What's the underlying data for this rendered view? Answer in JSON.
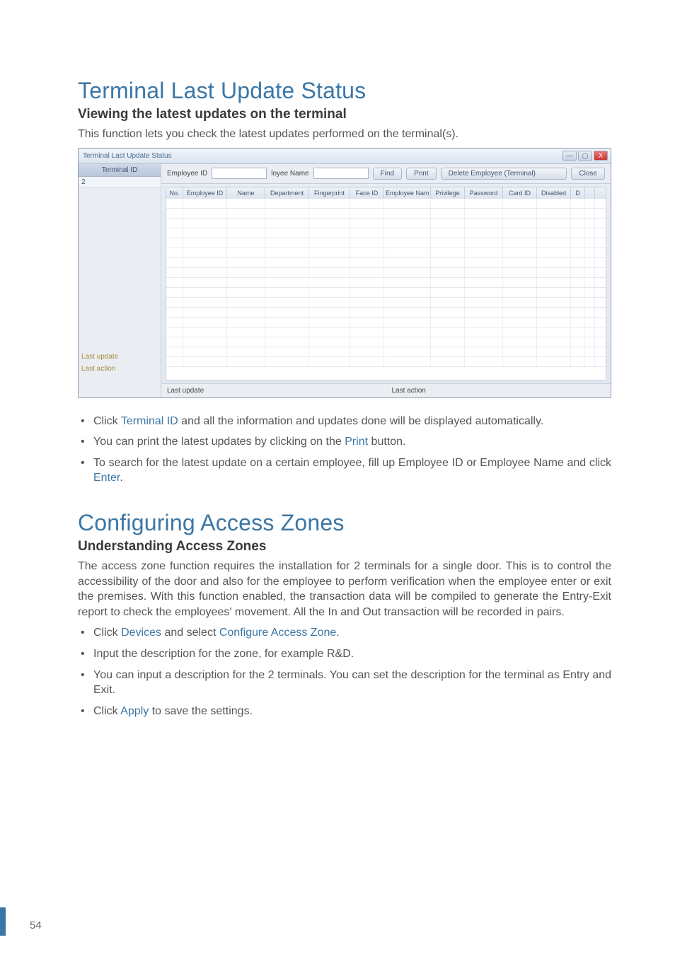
{
  "section1": {
    "title": "Terminal Last Update Status",
    "subtitle": "Viewing the latest updates on the terminal",
    "intro": "This function lets you check the latest updates performed on the terminal(s)."
  },
  "window": {
    "title": "Terminal Last Update Status",
    "controls": {
      "min": "—",
      "max": "▢",
      "close": "X"
    },
    "sidebar": {
      "header": "Terminal ID",
      "entry": "2",
      "link1": "Last update",
      "link2": "Last action"
    },
    "toolbar": {
      "label_empid": "Employee ID",
      "label_empname": "loyee Name",
      "btn_find": "Find",
      "btn_print": "Print",
      "btn_delete": "Delete Employee (Terminal)",
      "btn_close": "Close"
    },
    "columns": [
      "No.",
      "Employee ID",
      "Name",
      "Department",
      "Fingerprint",
      "Face ID",
      "Employee Nam",
      "Privilege",
      "Password",
      "Card ID",
      "Disabled",
      "D",
      ""
    ],
    "footer": {
      "left": "Last update",
      "right": "Last action"
    }
  },
  "instr1": {
    "i1a": "Click ",
    "i1b": "Terminal ID",
    "i1c": " and all the information and updates done will be displayed automatically.",
    "i2a": "You can print the latest updates by clicking on the ",
    "i2b": "Print",
    "i2c": " button.",
    "i3a": "To search for the latest update on a certain employee, fill up Employee ID or Employee Name and click ",
    "i3b": "Enter",
    "i3c": "."
  },
  "section2": {
    "title": "Configuring Access Zones",
    "subtitle": "Understanding Access Zones",
    "body": "The access zone function requires the installation for 2 terminals for a single door. This is to control the accessibility of the door and also for the employee to perform verification when the employee enter or exit the premises. With this function enabled, the transaction data will be compiled to generate the Entry-Exit report to check the employees' movement. All the In and Out transaction will be recorded in pairs."
  },
  "instr2": {
    "i1a": "Click ",
    "i1b": "Devices",
    "i1c": " and select ",
    "i1d": "Configure Access Zone",
    "i1e": ".",
    "i2": "Input the description for the zone, for example R&D.",
    "i3": "You can input a description for the 2 terminals. You can set the description for the terminal as Entry and Exit.",
    "i4a": "Click ",
    "i4b": "Apply",
    "i4c": " to save the settings."
  },
  "pageNumber": "54"
}
